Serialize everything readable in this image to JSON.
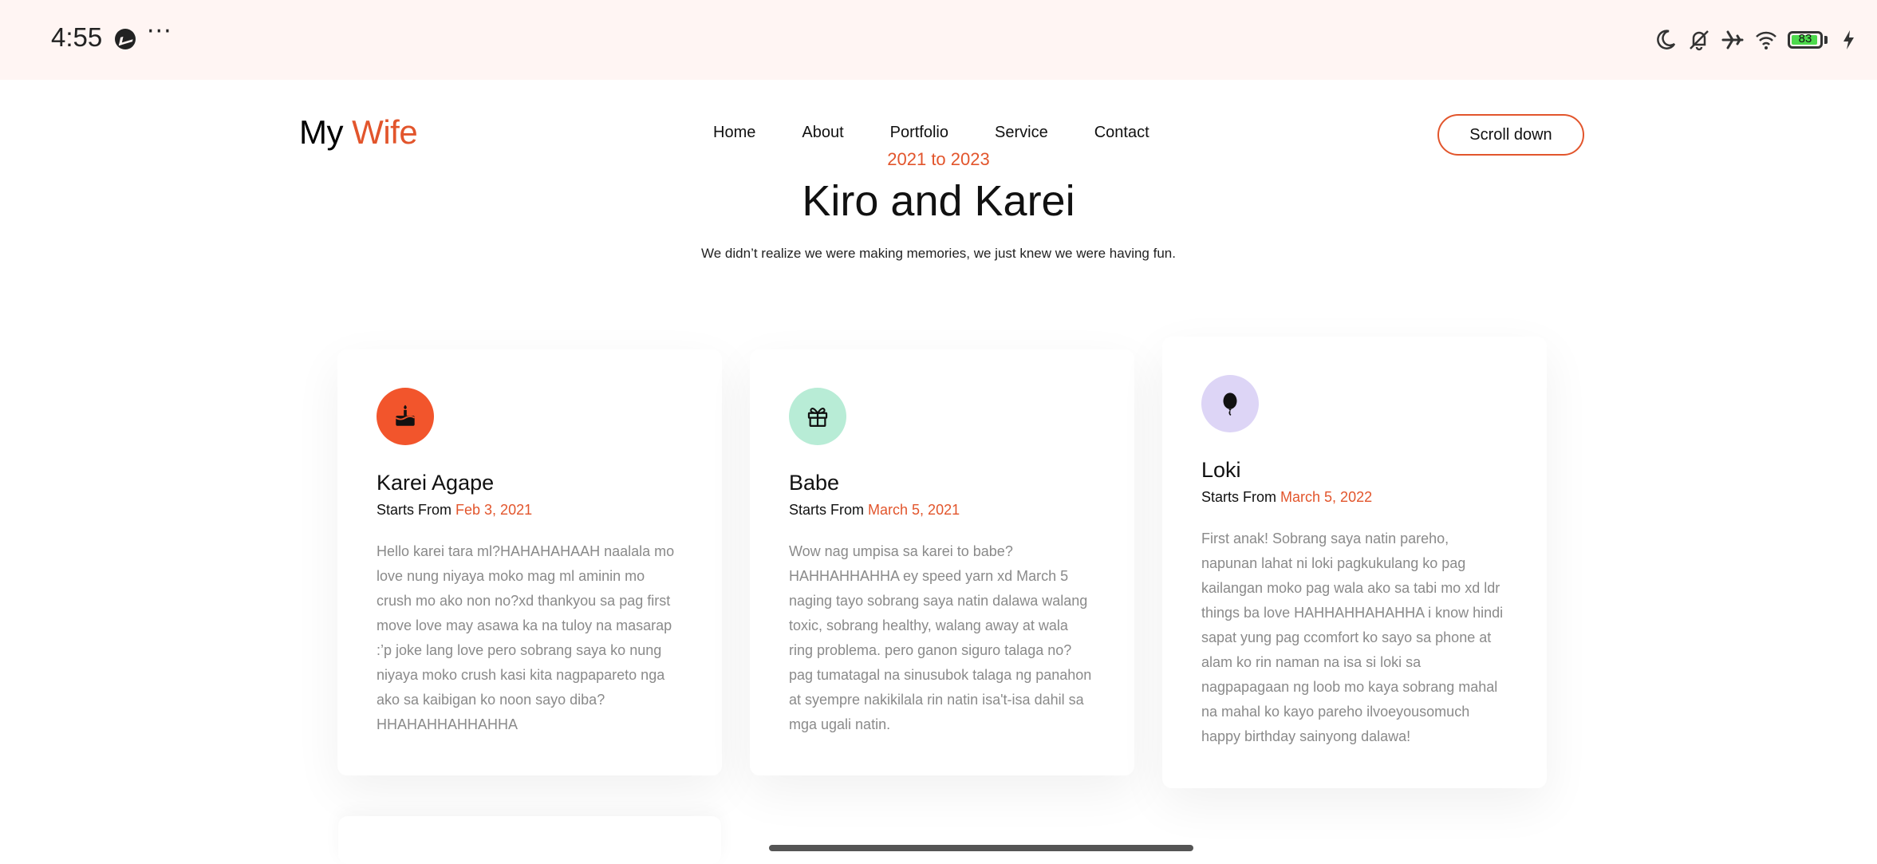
{
  "status_bar": {
    "time": "4:55",
    "left_icons": [
      "messenger-icon",
      "more-dots-icon"
    ],
    "more_dots": "···",
    "right_icons": [
      "moon-icon",
      "bell-off-icon",
      "airplane-icon",
      "wifi-icon",
      "battery-icon",
      "charging-bolt-icon"
    ],
    "battery_level": "83"
  },
  "header": {
    "logo_part1": "My",
    "logo_part2": "Wife",
    "nav": [
      "Home",
      "About",
      "Portfolio",
      "Service",
      "Contact"
    ],
    "scroll_button": "Scroll down"
  },
  "hero": {
    "range": "2021 to 2023",
    "title": "Kiro and Karei",
    "subtitle": "We didn’t realize we were making memories, we just knew we were having fun."
  },
  "cards": [
    {
      "icon": "cake-icon",
      "icon_bg": "#f2552c",
      "title": "Karei Agape",
      "starts_label": "Starts From",
      "date": "Feb 3, 2021",
      "text": "Hello karei tara ml?HAHAHAHAAH naalala mo love nung niyaya moko mag ml aminin mo crush mo ako non no?xd thankyou sa pag first move love may asawa ka na tuloy na masarap :’p joke lang love pero sobrang saya ko nung niyaya moko crush kasi kita nagpapareto nga ako sa kaibigan ko noon sayo diba? HHAHAHHAHHAHHA"
    },
    {
      "icon": "gift-icon",
      "icon_bg": "#b8ecd6",
      "title": "Babe",
      "starts_label": "Starts From",
      "date": "March 5, 2021",
      "text": "Wow nag umpisa sa karei to babe? HAHHAHHAHHA ey speed yarn xd March 5 naging tayo sobrang saya natin dalawa walang toxic, sobrang healthy, walang away at wala ring problema. pero ganon siguro talaga no? pag tumatagal na sinusubok talaga ng panahon at syempre nakikilala rin natin isa't-isa dahil sa mga ugali natin."
    },
    {
      "icon": "balloon-icon",
      "icon_bg": "#ddd5f6",
      "title": "Loki",
      "starts_label": "Starts From",
      "date": "March 5, 2022",
      "text": "First anak! Sobrang saya natin pareho, napunan lahat ni loki pagkukulang ko pag kailangan moko pag wala ako sa tabi mo xd ldr things ba love HAHHAHHAHAHHA i know hindi sapat yung pag ccomfort ko sayo sa phone at alam ko rin naman na isa si loki sa nagpapagaan ng loob mo kaya sobrang mahal na mahal ko kayo pareho ilvoeyousomuch happy birthday sainyong dalawa!"
    }
  ],
  "colors": {
    "accent": "#e2552c",
    "status_bar_bg": "#fff5f3",
    "body_text_muted": "#8a8a8a"
  }
}
